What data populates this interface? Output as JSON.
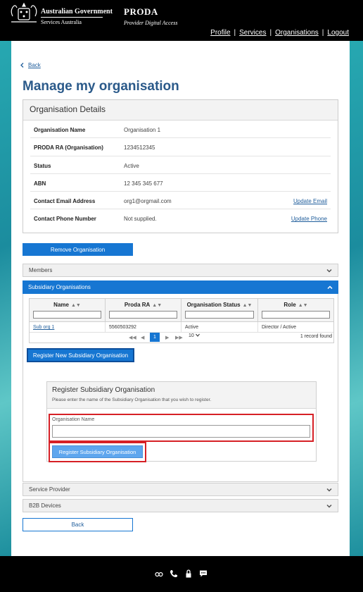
{
  "header": {
    "gov_line1": "Australian Government",
    "gov_line2": "Services Australia",
    "brand": "PRODA",
    "brand_sub": "Provider Digital Access",
    "nav": [
      {
        "label": "Profile"
      },
      {
        "label": "Services"
      },
      {
        "label": "Organisations"
      },
      {
        "label": "Logout"
      }
    ]
  },
  "page": {
    "back_link": "Back",
    "title": "Manage my organisation"
  },
  "org_details": {
    "title": "Organisation Details",
    "rows": [
      {
        "label": "Organisation Name",
        "value": "Organisation 1",
        "action": ""
      },
      {
        "label": "PRODA RA (Organisation)",
        "value": "1234512345",
        "action": ""
      },
      {
        "label": "Status",
        "value": "Active",
        "action": ""
      },
      {
        "label": "ABN",
        "value": "12 345 345 677",
        "action": ""
      },
      {
        "label": "Contact Email Address",
        "value": "org1@orgmail.com",
        "action": "Update Email"
      },
      {
        "label": "Contact Phone Number",
        "value": "Not supplied.",
        "action": "Update Phone"
      }
    ]
  },
  "remove_button": "Remove Organisation",
  "accordion": {
    "members": "Members",
    "subsidiary": "Subsidiary Organisations",
    "service_provider": "Service Provider",
    "b2b": "B2B Devices"
  },
  "subsidiary_table": {
    "columns": [
      "Name",
      "Proda RA",
      "Organisation Status",
      "Role"
    ],
    "rows": [
      {
        "name": "Sub org 1",
        "proda_ra": "5560503292",
        "status": "Active",
        "role": "Director / Active"
      }
    ],
    "pager": {
      "current": "1",
      "page_size": "10",
      "count": "1 record found"
    }
  },
  "register_new_button": "Register New Subsidiary Organisation",
  "register_panel": {
    "title": "Register Subsidiary Organisation",
    "description": "Please enter the name of the Subsidiary Organisation that you wish to register.",
    "field_label": "Organisation Name",
    "field_value": "",
    "submit_label": "Register Subsidiary Organisation"
  },
  "back_button": "Back",
  "colors": {
    "primary": "#1676d2",
    "header_bg": "#000000",
    "highlight": "#d62026",
    "title": "#2b5a8a"
  }
}
